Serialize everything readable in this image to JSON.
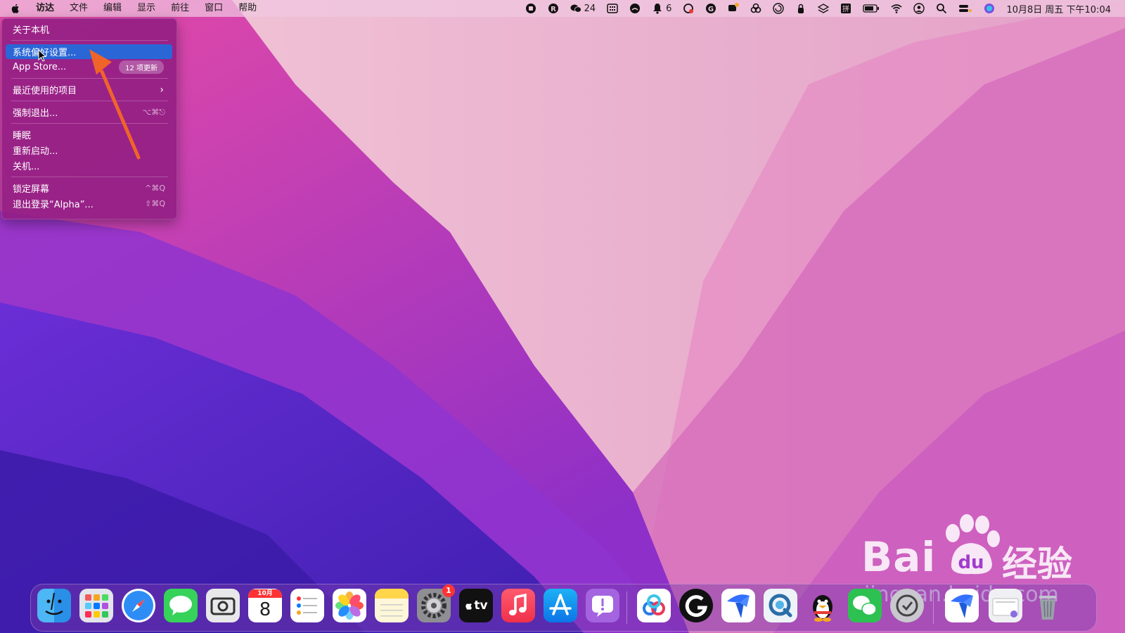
{
  "menubar": {
    "items": [
      "访达",
      "文件",
      "编辑",
      "显示",
      "前往",
      "窗口",
      "帮助"
    ],
    "wechat_count": "24",
    "notification_count": "6",
    "datetime": "10月8日 周五 下午10:04"
  },
  "apple_menu": {
    "about": "关于本机",
    "system_prefs": "系统偏好设置...",
    "app_store": "App Store...",
    "app_store_badge": "12 项更新",
    "recent_items": "最近使用的项目",
    "force_quit": "强制退出...",
    "force_quit_shortcut": "⌥⌘⎋",
    "sleep": "睡眠",
    "restart": "重新启动...",
    "shutdown": "关机...",
    "lock_screen": "锁定屏幕",
    "lock_shortcut": "^⌘Q",
    "logout": "退出登录“Alpha”...",
    "logout_shortcut": "⇧⌘Q"
  },
  "dock": {
    "calendar_month": "10月",
    "calendar_day": "8",
    "sysprefs_badge": "1",
    "tv_label": "tv"
  },
  "watermark": {
    "brand": "Bai",
    "brand2": "经验",
    "paw_text": "du",
    "url": "jingyan.baidu.com"
  },
  "colors": {
    "selection": "#2a66d6",
    "arrow": "#f0642a"
  }
}
